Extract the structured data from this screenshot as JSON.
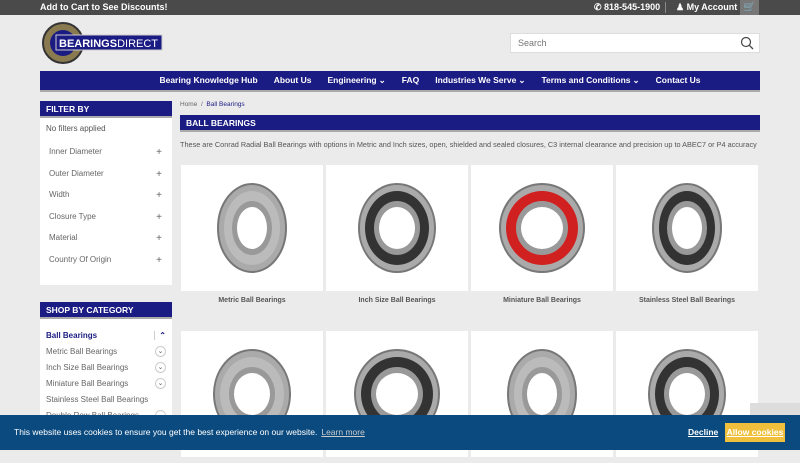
{
  "topbar": {
    "promo": "Add to Cart to See Discounts!",
    "phone": "818-545-1900",
    "account": "My Account"
  },
  "logo": {
    "text_bold": "BEARINGS",
    "text_light": "DIRECT"
  },
  "search": {
    "placeholder": "Search"
  },
  "nav": [
    {
      "label": "Bearing Knowledge Hub",
      "dropdown": false
    },
    {
      "label": "About Us",
      "dropdown": false
    },
    {
      "label": "Engineering",
      "dropdown": true
    },
    {
      "label": "FAQ",
      "dropdown": false
    },
    {
      "label": "Industries We Serve",
      "dropdown": true
    },
    {
      "label": "Terms and Conditions",
      "dropdown": true
    },
    {
      "label": "Contact Us",
      "dropdown": false
    }
  ],
  "filter": {
    "title": "FILTER BY",
    "none": "No filters applied",
    "items": [
      "Inner Diameter",
      "Outer Diameter",
      "Width",
      "Closure Type",
      "Material",
      "Country Of Origin"
    ]
  },
  "category": {
    "title": "SHOP BY CATEGORY",
    "items": [
      {
        "label": "Ball Bearings",
        "active": true
      },
      {
        "label": "Metric Ball Bearings"
      },
      {
        "label": "Inch Size Ball Bearings"
      },
      {
        "label": "Miniature Ball Bearings"
      },
      {
        "label": "Stainless Steel Ball Bearings"
      },
      {
        "label": "Double Row Ball Bearings"
      }
    ]
  },
  "breadcrumb": [
    "Home",
    "Ball Bearings"
  ],
  "page": {
    "title": "BALL BEARINGS",
    "description": "These are Conrad Radial Ball Bearings with options in Metric and Inch sizes, open, shielded and sealed closures, C3 internal clearance and precision up to ABEC7 or P4 accuracy"
  },
  "products": [
    {
      "label": "Metric Ball Bearings"
    },
    {
      "label": "Inch Size Ball Bearings"
    },
    {
      "label": "Miniature Ball Bearings",
      "seal_color": "#d02020"
    },
    {
      "label": "Stainless Steel Ball Bearings"
    },
    {
      "label": ""
    },
    {
      "label": ""
    },
    {
      "label": ""
    },
    {
      "label": ""
    }
  ],
  "cookie": {
    "message": "This website uses cookies to ensure you get the best experience on our website.",
    "learn": "Learn more",
    "decline": "Decline",
    "allow": "Allow cookies"
  },
  "colors": {
    "brand": "#1b1b84",
    "cookie_bg": "#0b4a7f",
    "allow": "#f0c03c"
  }
}
